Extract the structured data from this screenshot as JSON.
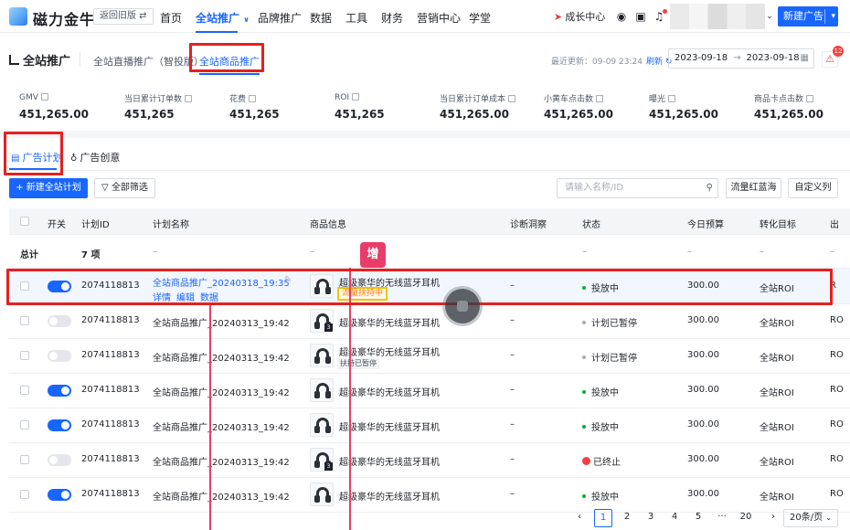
{
  "brand": {
    "name": "磁力金牛",
    "old_version": "返回旧版"
  },
  "nav": {
    "items": [
      "首页",
      "全站推广",
      "品牌推广",
      "数据",
      "工具",
      "财务",
      "营销中心",
      "学堂"
    ],
    "growth_center": "成长中心",
    "new_ad": "新建广告"
  },
  "header": {
    "title": "全站推广",
    "subtabs": [
      "全站直播推广（智投版）",
      "全站商品推广"
    ],
    "last_update_label": "最近更新：09-09 23:24",
    "refresh": "刷新",
    "date_start": "2023-09-18",
    "date_end": "2023-09-18",
    "alarm_count": "12"
  },
  "metrics": [
    {
      "label": "GMV",
      "value": "451,265.00"
    },
    {
      "label": "当日累计订单数",
      "value": "451,265"
    },
    {
      "label": "花费",
      "value": "451,265"
    },
    {
      "label": "ROI",
      "value": "451,265"
    },
    {
      "label": "当日累计订单成本",
      "value": "451,265.00"
    },
    {
      "label": "小黄车点击数",
      "value": "451,265.00"
    },
    {
      "label": "曝光",
      "value": "451,265.00"
    },
    {
      "label": "商品卡点击数",
      "value": "451,265.00"
    }
  ],
  "tabs": {
    "plan": "广告计划",
    "creative": "广告创意"
  },
  "toolbar": {
    "new_plan": "+ 新建全站计划",
    "filter": "全部筛选",
    "search_placeholder": "请输入名称/ID",
    "flow_ocean": "流量红蓝海",
    "custom_cols": "自定义列"
  },
  "table": {
    "columns": [
      "开关",
      "计划ID",
      "计划名称",
      "商品信息",
      "诊断洞察",
      "状态",
      "今日预算",
      "转化目标",
      "出"
    ],
    "total_row": {
      "label": "总计",
      "count": "7 项",
      "dash": "–"
    },
    "rows": [
      {
        "switch": "on",
        "id": "2074118813",
        "name": "全站商品推广_20240318_19:35",
        "links": [
          "详情",
          "编辑",
          "数据"
        ],
        "product": "超级豪华的无线蓝牙耳机",
        "tag": "流量扶持中",
        "insight": "–",
        "status": "投放中",
        "status_color": "#00b42a",
        "budget": "300.00",
        "target": "全站ROI",
        "extra": "R"
      },
      {
        "switch": "off",
        "id": "2074118813",
        "name": "全站商品推广_20240313_19:42",
        "product": "超级豪华的无线蓝牙耳机",
        "qty": "3",
        "insight": "–",
        "status": "计划已暂停",
        "status_color": "#a9aeb8",
        "budget": "300.00",
        "target": "全站ROI",
        "extra": "RO"
      },
      {
        "switch": "off",
        "id": "2074118813",
        "name": "全站商品推广_20240313_19:42",
        "product": "超级豪华的无线蓝牙耳机",
        "tag": "扶持已暂停",
        "insight": "–",
        "status": "计划已暂停",
        "status_color": "#a9aeb8",
        "budget": "300.00",
        "target": "全站ROI",
        "extra": "RO"
      },
      {
        "switch": "on",
        "id": "2074118813",
        "name": "全站商品推广_20240313_19:42",
        "product": "超级豪华的无线蓝牙耳机",
        "insight": "–",
        "status": "投放中",
        "status_color": "#00b42a",
        "budget": "300.00",
        "target": "全站ROI",
        "extra": "RO"
      },
      {
        "switch": "on",
        "id": "2074118813",
        "name": "全站商品推广_20240313_19:42",
        "product": "超级豪华的无线蓝牙耳机",
        "insight": "–",
        "status": "投放中",
        "status_color": "#00b42a",
        "budget": "300.00",
        "target": "全站ROI",
        "extra": "RO"
      },
      {
        "switch": "off",
        "id": "2074118813",
        "name": "全站商品推广_20240313_19:42",
        "product": "超级豪华的无线蓝牙耳机",
        "qty": "3",
        "insight": "–",
        "status": "已终止",
        "status_color": "#f53f3f",
        "budget": "300.00",
        "target": "全站ROI",
        "extra": "RO"
      },
      {
        "switch": "on",
        "id": "2074118813",
        "name": "全站商品推广_20240313_19:42",
        "product": "超级豪华的无线蓝牙耳机",
        "insight": "–",
        "status": "投放中",
        "status_color": "#00b42a",
        "budget": "300.00",
        "target": "全站ROI",
        "extra": "RO"
      }
    ]
  },
  "annotation": {
    "marker": "增"
  },
  "pagination": {
    "pages": [
      "1",
      "2",
      "3",
      "4",
      "5",
      "···",
      "20"
    ],
    "page_size": "20条/页"
  },
  "colors": {
    "primary": "#1966ff",
    "annotation_red": "#e5201f",
    "marker_pink": "#e83d6a"
  }
}
